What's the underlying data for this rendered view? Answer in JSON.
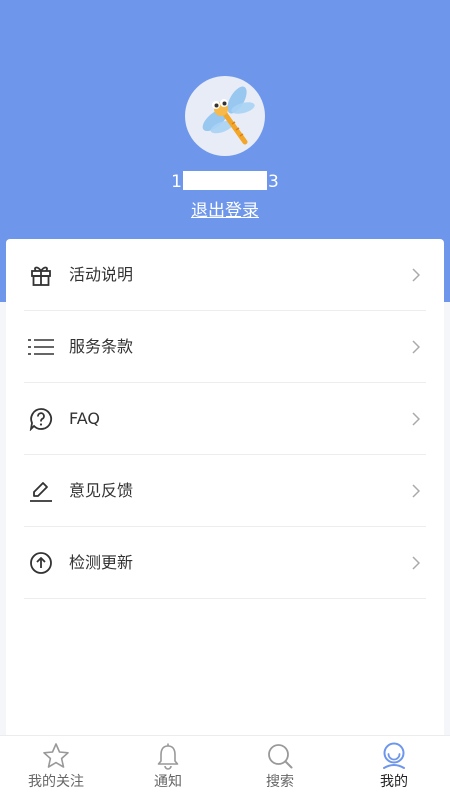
{
  "header": {
    "phone_prefix": "1",
    "phone_suffix": "3",
    "logout_label": "退出登录",
    "background_color": "#6e96ea"
  },
  "menu": {
    "items": [
      {
        "label": "活动说明",
        "icon": "gift-icon"
      },
      {
        "label": "服务条款",
        "icon": "list-icon"
      },
      {
        "label": "FAQ",
        "icon": "question-bubble-icon"
      },
      {
        "label": "意见反馈",
        "icon": "edit-pencil-icon"
      },
      {
        "label": "检测更新",
        "icon": "upload-arrow-circle-icon"
      }
    ]
  },
  "tabbar": {
    "tabs": [
      {
        "label": "我的关注",
        "icon": "star-icon"
      },
      {
        "label": "通知",
        "icon": "bell-icon"
      },
      {
        "label": "搜索",
        "icon": "search-icon"
      },
      {
        "label": "我的",
        "icon": "user-icon",
        "active": true
      }
    ],
    "active_color": "#6e96ea"
  }
}
